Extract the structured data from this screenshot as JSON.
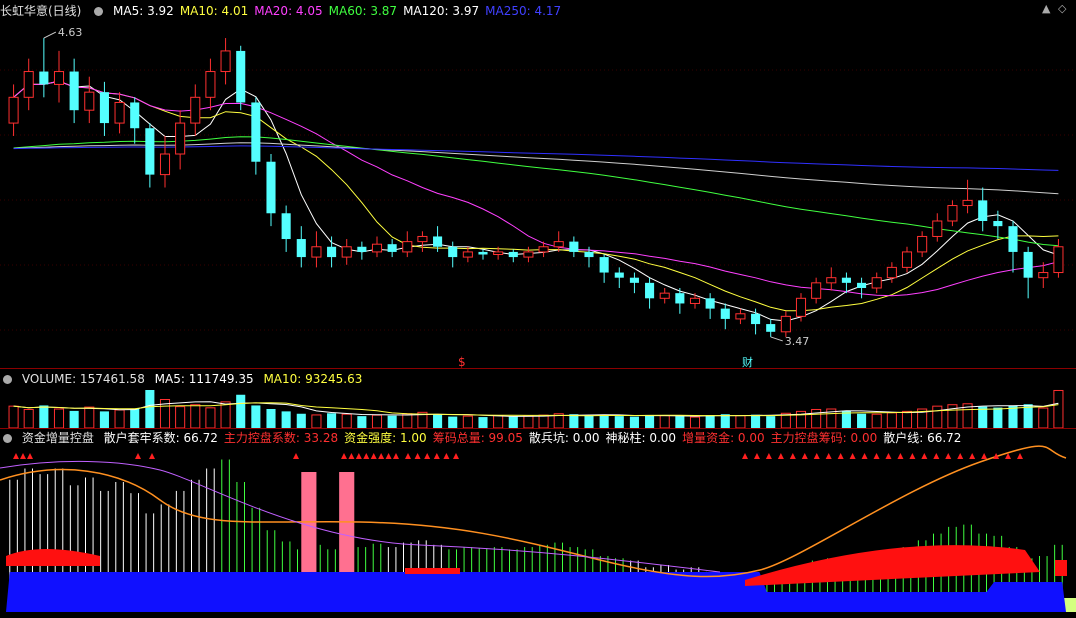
{
  "main": {
    "title": "长虹华意(日线)",
    "indicators": [
      {
        "label": "MA5: 3.92",
        "color": "#ffffff"
      },
      {
        "label": "MA10: 4.01",
        "color": "#ffff40"
      },
      {
        "label": "MA20: 4.05",
        "color": "#ff40ff"
      },
      {
        "label": "MA60: 3.87",
        "color": "#40ff40"
      },
      {
        "label": "MA120: 3.97",
        "color": "#ffffff"
      },
      {
        "label": "MA250: 4.17",
        "color": "#4040ff"
      }
    ],
    "high_label": "4.63",
    "low_label": "3.47",
    "marker_s": "$",
    "marker_cai": "财"
  },
  "volume": {
    "label": "VOLUME: 157461.58",
    "ma5": "MA5: 111749.35",
    "ma10": "MA10: 93245.63"
  },
  "indicator": {
    "name": "资金增量控盘",
    "items": [
      {
        "label": "散户套牢系数: 66.72",
        "color": "#ffffff"
      },
      {
        "label": "主力控盘系数: 33.28",
        "color": "#ff3030"
      },
      {
        "label": "资金强度: 1.00",
        "color": "#ffff40"
      },
      {
        "label": "筹码总量: 99.05",
        "color": "#ff3030"
      },
      {
        "label": "散兵坑: 0.00",
        "color": "#ffffff"
      },
      {
        "label": "神秘柱: 0.00",
        "color": "#ffffff"
      },
      {
        "label": "增量资金: 0.00",
        "color": "#ff3030"
      },
      {
        "label": "主力控盘筹码: 0.00",
        "color": "#ff3030"
      },
      {
        "label": "散户线: 66.72",
        "color": "#ffffff"
      }
    ]
  },
  "colors": {
    "up": "#ff3030",
    "down": "#54ffff",
    "bg": "#000000",
    "blue": "#1010ff"
  },
  "chart_data": {
    "type": "candlestick",
    "y_range": [
      3.4,
      4.7
    ],
    "candles": [
      [
        4.3,
        4.4,
        4.25,
        4.45
      ],
      [
        4.4,
        4.5,
        4.35,
        4.55
      ],
      [
        4.5,
        4.45,
        4.4,
        4.63
      ],
      [
        4.45,
        4.5,
        4.38,
        4.58
      ],
      [
        4.5,
        4.35,
        4.3,
        4.55
      ],
      [
        4.35,
        4.42,
        4.3,
        4.48
      ],
      [
        4.42,
        4.3,
        4.25,
        4.46
      ],
      [
        4.3,
        4.38,
        4.26,
        4.42
      ],
      [
        4.38,
        4.28,
        4.22,
        4.4
      ],
      [
        4.28,
        4.1,
        4.05,
        4.3
      ],
      [
        4.1,
        4.18,
        4.05,
        4.25
      ],
      [
        4.18,
        4.3,
        4.12,
        4.35
      ],
      [
        4.3,
        4.4,
        4.25,
        4.45
      ],
      [
        4.4,
        4.5,
        4.35,
        4.55
      ],
      [
        4.5,
        4.58,
        4.45,
        4.63
      ],
      [
        4.58,
        4.38,
        4.35,
        4.6
      ],
      [
        4.38,
        4.15,
        4.1,
        4.4
      ],
      [
        4.15,
        3.95,
        3.9,
        4.18
      ],
      [
        3.95,
        3.85,
        3.8,
        3.98
      ],
      [
        3.85,
        3.78,
        3.74,
        3.9
      ],
      [
        3.78,
        3.82,
        3.74,
        3.88
      ],
      [
        3.82,
        3.78,
        3.74,
        3.86
      ],
      [
        3.78,
        3.82,
        3.75,
        3.85
      ],
      [
        3.82,
        3.8,
        3.77,
        3.84
      ],
      [
        3.8,
        3.83,
        3.78,
        3.86
      ],
      [
        3.83,
        3.8,
        3.78,
        3.85
      ],
      [
        3.8,
        3.84,
        3.78,
        3.88
      ],
      [
        3.84,
        3.86,
        3.8,
        3.88
      ],
      [
        3.86,
        3.82,
        3.8,
        3.9
      ],
      [
        3.82,
        3.78,
        3.74,
        3.84
      ],
      [
        3.78,
        3.8,
        3.76,
        3.82
      ],
      [
        3.8,
        3.79,
        3.77,
        3.81
      ],
      [
        3.79,
        3.8,
        3.77,
        3.82
      ],
      [
        3.8,
        3.78,
        3.76,
        3.81
      ],
      [
        3.78,
        3.8,
        3.76,
        3.82
      ],
      [
        3.8,
        3.82,
        3.78,
        3.84
      ],
      [
        3.82,
        3.84,
        3.8,
        3.88
      ],
      [
        3.84,
        3.8,
        3.78,
        3.86
      ],
      [
        3.8,
        3.78,
        3.74,
        3.82
      ],
      [
        3.78,
        3.72,
        3.68,
        3.79
      ],
      [
        3.72,
        3.7,
        3.66,
        3.74
      ],
      [
        3.7,
        3.68,
        3.64,
        3.72
      ],
      [
        3.68,
        3.62,
        3.58,
        3.7
      ],
      [
        3.62,
        3.64,
        3.6,
        3.66
      ],
      [
        3.64,
        3.6,
        3.56,
        3.66
      ],
      [
        3.6,
        3.62,
        3.58,
        3.64
      ],
      [
        3.62,
        3.58,
        3.54,
        3.64
      ],
      [
        3.58,
        3.54,
        3.5,
        3.6
      ],
      [
        3.54,
        3.56,
        3.52,
        3.58
      ],
      [
        3.56,
        3.52,
        3.48,
        3.58
      ],
      [
        3.52,
        3.49,
        3.47,
        3.54
      ],
      [
        3.49,
        3.55,
        3.47,
        3.57
      ],
      [
        3.55,
        3.62,
        3.53,
        3.64
      ],
      [
        3.62,
        3.68,
        3.6,
        3.7
      ],
      [
        3.68,
        3.7,
        3.65,
        3.74
      ],
      [
        3.7,
        3.68,
        3.64,
        3.72
      ],
      [
        3.68,
        3.66,
        3.62,
        3.7
      ],
      [
        3.66,
        3.7,
        3.64,
        3.72
      ],
      [
        3.7,
        3.74,
        3.68,
        3.76
      ],
      [
        3.74,
        3.8,
        3.72,
        3.82
      ],
      [
        3.8,
        3.86,
        3.78,
        3.88
      ],
      [
        3.86,
        3.92,
        3.84,
        3.95
      ],
      [
        3.92,
        3.98,
        3.9,
        4.0
      ],
      [
        3.98,
        4.0,
        3.95,
        4.08
      ],
      [
        4.0,
        3.92,
        3.88,
        4.05
      ],
      [
        3.92,
        3.9,
        3.85,
        3.96
      ],
      [
        3.9,
        3.8,
        3.72,
        3.92
      ],
      [
        3.8,
        3.7,
        3.62,
        3.82
      ],
      [
        3.7,
        3.72,
        3.66,
        3.76
      ],
      [
        3.72,
        3.82,
        3.7,
        3.85
      ]
    ],
    "ma_series": [
      {
        "name": "MA5",
        "color": "#ffffff"
      },
      {
        "name": "MA10",
        "color": "#ffff40"
      },
      {
        "name": "MA20",
        "color": "#ff40ff"
      },
      {
        "name": "MA60",
        "color": "#40ff40"
      },
      {
        "name": "MA120",
        "color": "#ffffff"
      },
      {
        "name": "MA250",
        "color": "#4040ff"
      }
    ],
    "volume": [
      92,
      78,
      95,
      80,
      72,
      88,
      70,
      76,
      82,
      160,
      120,
      90,
      98,
      85,
      110,
      140,
      95,
      80,
      70,
      60,
      55,
      62,
      58,
      50,
      54,
      52,
      60,
      66,
      58,
      48,
      50,
      46,
      52,
      48,
      50,
      54,
      60,
      58,
      52,
      56,
      50,
      48,
      55,
      52,
      50,
      46,
      54,
      58,
      52,
      56,
      50,
      62,
      70,
      78,
      80,
      72,
      60,
      58,
      64,
      70,
      80,
      92,
      98,
      102,
      90,
      86,
      94,
      100,
      84,
      158
    ]
  }
}
